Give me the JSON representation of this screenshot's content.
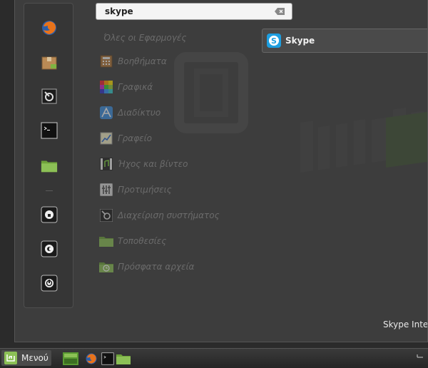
{
  "search": {
    "value": "skype"
  },
  "categories": [
    {
      "name": "all",
      "label": "Όλες οι Εφαρμογές"
    },
    {
      "name": "accessories",
      "label": "Βοηθήματα",
      "icon": "calculator-icon"
    },
    {
      "name": "graphics",
      "label": "Γραφικά",
      "icon": "graphics-icon"
    },
    {
      "name": "internet",
      "label": "Διαδίκτυο",
      "icon": "internet-icon"
    },
    {
      "name": "office",
      "label": "Γραφείο",
      "icon": "office-icon"
    },
    {
      "name": "sound-video",
      "label": "Ήχος και βίντεο",
      "icon": "media-icon"
    },
    {
      "name": "preferences",
      "label": "Προτιμήσεις",
      "icon": "preferences-icon"
    },
    {
      "name": "administration",
      "label": "Διαχείριση συστήματος",
      "icon": "admin-icon"
    },
    {
      "name": "places",
      "label": "Τοποθεσίες",
      "icon": "folder-icon"
    },
    {
      "name": "recent",
      "label": "Πρόσφατα αρχεία",
      "icon": "recent-files-icon"
    }
  ],
  "results": [
    {
      "label": "Skype",
      "icon": "skype-icon"
    }
  ],
  "description": "Skype Inte",
  "favorites": [
    "firefox-icon",
    "package-manager-icon",
    "system-settings-icon",
    "terminal-icon",
    "home-folder-icon",
    "lock-screen-icon",
    "logout-icon",
    "shutdown-icon"
  ],
  "panel": {
    "menu_label": "Μενού",
    "launchers": [
      "show-desktop-icon",
      "firefox-icon",
      "terminal-icon",
      "folder-icon"
    ]
  },
  "colors": {
    "menu_bg": "#3d3d3d",
    "category_text": "#6b6b6b",
    "result_text": "#f0f0f0",
    "mint_green": "#7fb342"
  }
}
